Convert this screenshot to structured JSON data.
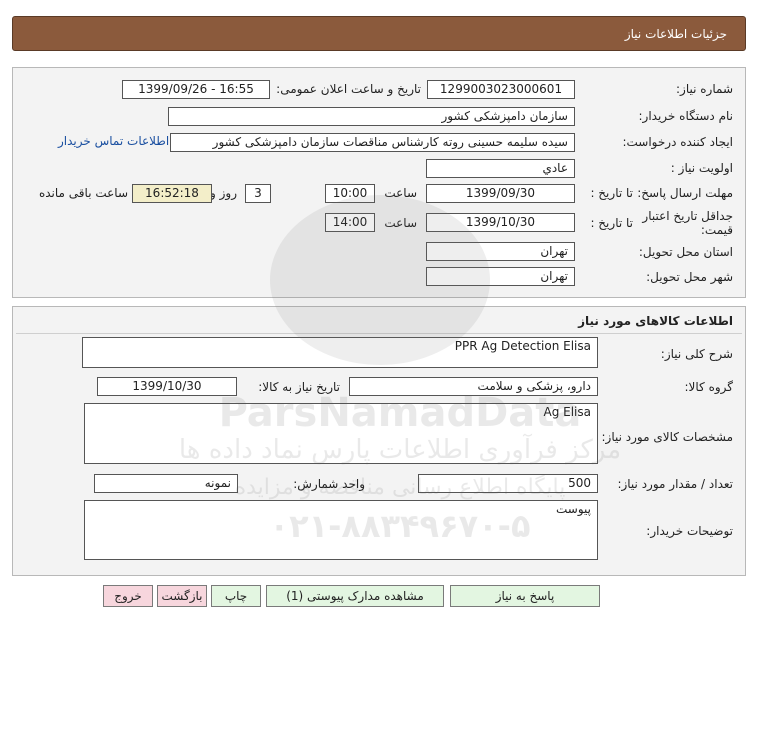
{
  "header": {
    "title": "جزئیات اطلاعات نیاز"
  },
  "need": {
    "need_number_label": "شماره نیاز:",
    "need_number": "1299003023000601",
    "announce_label": "تاریخ و ساعت اعلان عمومی:",
    "announce_value": "1399/09/26 - 16:55",
    "buyer_org_label": "نام دستگاه خریدار:",
    "buyer_org": "سازمان دامپزشکی کشور",
    "creator_label": "ایجاد کننده درخواست:",
    "creator": "سیده سلیمه  حسینی روته کارشناس مناقصات سازمان دامپزشکی کشور",
    "contact_link": "اطلاعات تماس خریدار",
    "priority_label": "اولویت نیاز :",
    "priority": "عادي",
    "deadline_label": "مهلت ارسال پاسخ:",
    "to_date_label": "تا تاریخ :",
    "deadline_date": "1399/09/30",
    "time_label": "ساعت",
    "deadline_time": "10:00",
    "days_value": "3",
    "days_label": "روز و",
    "remaining_time": "16:52:18",
    "remaining_label": "ساعت باقی مانده",
    "validity_label": "جداقل تاریخ اعتبار قیمت:",
    "validity_to_label": "تا تاریخ :",
    "validity_date": "1399/10/30",
    "validity_time_label": "ساعت",
    "validity_time": "14:00",
    "province_label": "استان محل تحویل:",
    "province": "تهران",
    "city_label": "شهر محل تحویل:",
    "city": "تهران"
  },
  "goods": {
    "section_title": "اطلاعات کالاهای مورد نیاز",
    "summary_label": "شرح کلی نیاز:",
    "summary": "PPR Ag Detection Elisa",
    "group_label": "گروه کالا:",
    "group": "دارو، پزشکی و سلامت",
    "need_date_label": "تاریخ نیاز به کالا:",
    "need_date": "1399/10/30",
    "specs_label": "مشخصات کالای مورد نیاز:",
    "specs": "Ag Elisa",
    "qty_label": "تعداد / مقدار مورد نیاز:",
    "qty": "500",
    "unit_label": "واحد شمارش:",
    "unit": "نمونه",
    "buyer_notes_label": "توضیحات خریدار:",
    "buyer_notes": "پیوست"
  },
  "buttons": {
    "reply": "پاسخ به نیاز",
    "view_docs": "مشاهده مدارک پیوستی (1)",
    "print": "چاپ",
    "back": "بازگشت",
    "exit": "خروج"
  },
  "watermark": {
    "brand": "ParsNamadData",
    "line1": "مرکز فرآوری اطلاعات پارس نماد داده ها",
    "line2": "پایگاه اطلاع رسانی مناقصه و مزایده",
    "phone": "۰۲۱-۸۸۳۴۹۶۷۰-۵"
  },
  "colors": {
    "header_bg": "#8b5a3c",
    "panel_bg": "#f3f3f3",
    "remaining_bg": "#f3eec9",
    "reply_btn_bg": "#e3f6e1",
    "exit_btn_bg": "#f7d6dd",
    "link": "#1a4fa0"
  }
}
